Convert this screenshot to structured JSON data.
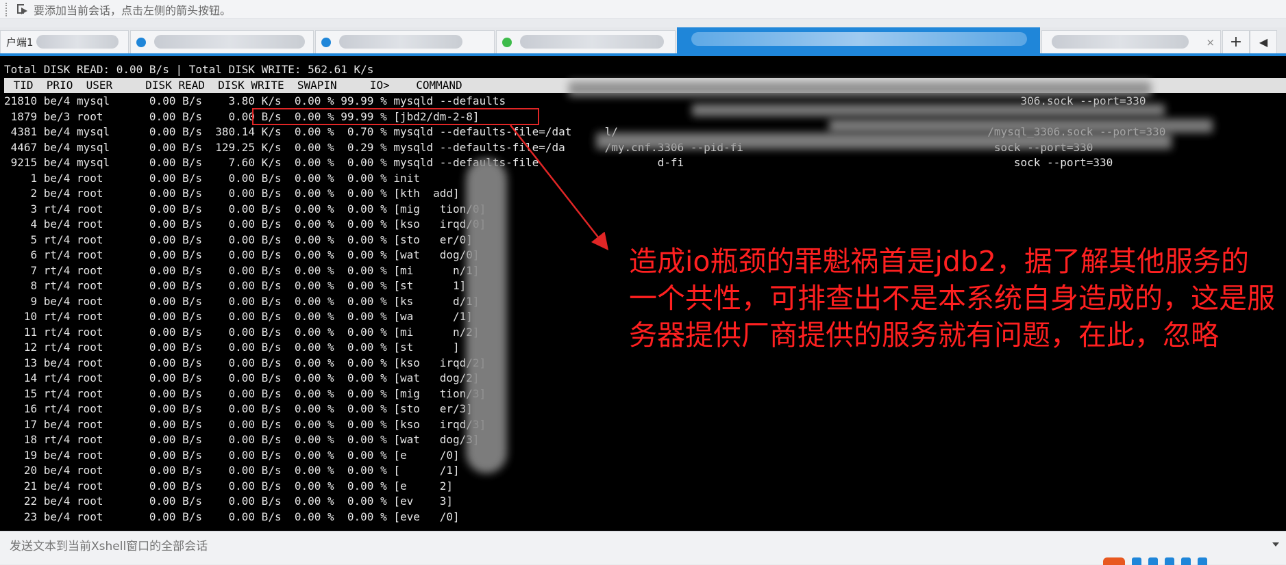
{
  "topbar": {
    "hint": "要添加当前会话，点击左侧的箭头按钮。"
  },
  "tabs": {
    "first_label": "户端1",
    "active_tab_close": "×"
  },
  "terminal": {
    "totals": "Total DISK READ: 0.00 B/s | Total DISK WRITE: 562.61 K/s",
    "header": " TID  PRIO  USER     DISK READ  DISK WRITE  SWAPIN     IO>    COMMAND",
    "rows": [
      "21810 be/4 mysql      0.00 B/s    3.80 K/s  0.00 % 99.99 % mysqld --defaults                                                                              306.sock --port=330",
      " 1879 be/3 root       0.00 B/s    0.00 B/s  0.00 % 99.99 % [jbd2/dm-2-8]",
      " 4381 be/4 mysql      0.00 B/s  380.14 K/s  0.00 %  0.70 % mysqld --defaults-file=/dat     l/                                                        /mysql_3306.sock --port=330",
      " 4467 be/4 mysql      0.00 B/s  129.25 K/s  0.00 %  0.29 % mysqld --defaults-file=/da      /my.cnf.3306 --pid-fi                                      sock --port=330",
      " 9215 be/4 mysql      0.00 B/s    7.60 K/s  0.00 %  0.00 % mysqld --defaults-file                  d-fi                                                  sock --port=330",
      "    1 be/4 root       0.00 B/s    0.00 B/s  0.00 %  0.00 % init",
      "    2 be/4 root       0.00 B/s    0.00 B/s  0.00 %  0.00 % [kth  add]",
      "    3 rt/4 root       0.00 B/s    0.00 B/s  0.00 %  0.00 % [mig   tion/0]",
      "    4 be/4 root       0.00 B/s    0.00 B/s  0.00 %  0.00 % [kso   irqd/0]",
      "    5 rt/4 root       0.00 B/s    0.00 B/s  0.00 %  0.00 % [sto   er/0]",
      "    6 rt/4 root       0.00 B/s    0.00 B/s  0.00 %  0.00 % [wat   dog/0]",
      "    7 rt/4 root       0.00 B/s    0.00 B/s  0.00 %  0.00 % [mi      n/1]",
      "    8 rt/4 root       0.00 B/s    0.00 B/s  0.00 %  0.00 % [st      1]",
      "    9 be/4 root       0.00 B/s    0.00 B/s  0.00 %  0.00 % [ks      d/1]",
      "   10 rt/4 root       0.00 B/s    0.00 B/s  0.00 %  0.00 % [wa      /1]",
      "   11 rt/4 root       0.00 B/s    0.00 B/s  0.00 %  0.00 % [mi      n/2]",
      "   12 rt/4 root       0.00 B/s    0.00 B/s  0.00 %  0.00 % [st      ]",
      "   13 be/4 root       0.00 B/s    0.00 B/s  0.00 %  0.00 % [kso   irqd/2]",
      "   14 rt/4 root       0.00 B/s    0.00 B/s  0.00 %  0.00 % [wat   dog/2]",
      "   15 rt/4 root       0.00 B/s    0.00 B/s  0.00 %  0.00 % [mig   tion/3]",
      "   16 rt/4 root       0.00 B/s    0.00 B/s  0.00 %  0.00 % [sto   er/3]",
      "   17 be/4 root       0.00 B/s    0.00 B/s  0.00 %  0.00 % [kso   irqd/3]",
      "   18 rt/4 root       0.00 B/s    0.00 B/s  0.00 %  0.00 % [wat   dog/3]",
      "   19 be/4 root       0.00 B/s    0.00 B/s  0.00 %  0.00 % [e     /0]",
      "   20 be/4 root       0.00 B/s    0.00 B/s  0.00 %  0.00 % [      /1]",
      "   21 be/4 root       0.00 B/s    0.00 B/s  0.00 %  0.00 % [e     2]",
      "   22 be/4 root       0.00 B/s    0.00 B/s  0.00 %  0.00 % [ev    3]",
      "   23 be/4 root       0.00 B/s    0.00 B/s  0.00 %  0.00 % [eve   /0]"
    ]
  },
  "annotation": {
    "text": "造成io瓶颈的罪魁祸首是jdb2，据了解其他服务的一个共性，可排查出不是本系统自身造成的，这是服务器提供厂商提供的服务就有问题，在此，忽略",
    "color": "#ff2020"
  },
  "bottombar": {
    "placeholder": "发送文本到当前Xshell窗口的全部会话"
  },
  "colors": {
    "accent": "#1f86d9",
    "terminal_bg": "#000000",
    "highlight": "#e12626"
  }
}
